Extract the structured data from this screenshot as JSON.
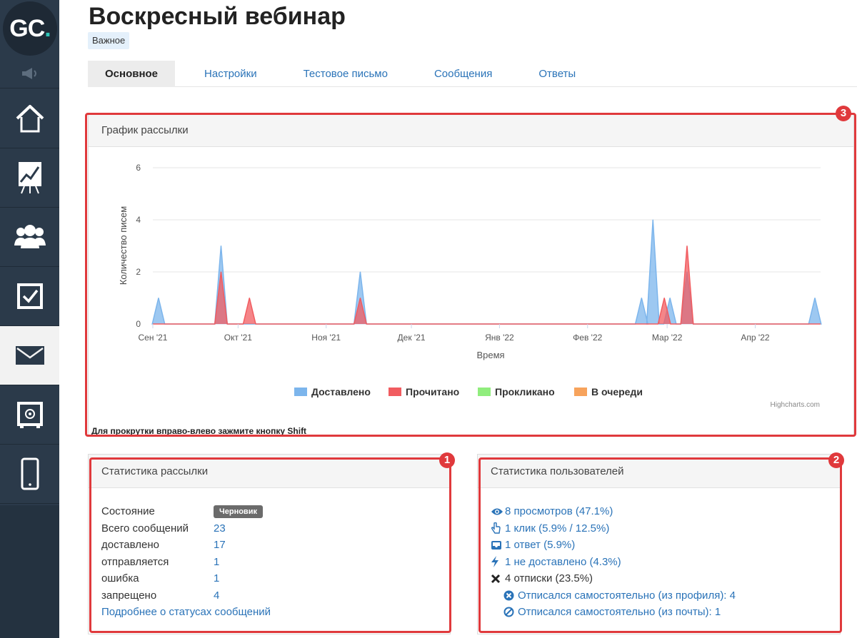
{
  "logo": {
    "text_main": "GC",
    "text_dot": "."
  },
  "sidebar": {
    "items": [
      {
        "name": "home"
      },
      {
        "name": "training"
      },
      {
        "name": "users"
      },
      {
        "name": "tasks"
      },
      {
        "name": "mail",
        "active": true
      },
      {
        "name": "safe"
      },
      {
        "name": "mobile"
      }
    ]
  },
  "page": {
    "title": "Воскресный вебинар",
    "tag": "Важное"
  },
  "tabs": [
    {
      "label": "Основное",
      "active": true
    },
    {
      "label": "Настройки"
    },
    {
      "label": "Тестовое письмо"
    },
    {
      "label": "Сообщения"
    },
    {
      "label": "Ответы"
    }
  ],
  "chart_panel": {
    "title": "График рассылки",
    "credit": "Highcharts.com",
    "scroll_note": "Для прокрутки вправо-влево зажмите кнопку Shift",
    "badge": "3"
  },
  "chart_data": {
    "type": "area",
    "ylabel": "Количество писем",
    "xlabel": "Время",
    "ylim": [
      0,
      6
    ],
    "yticks": [
      0,
      2,
      4,
      6
    ],
    "xlim": [
      "2021-09-01",
      "2022-04-24"
    ],
    "xticks": [
      {
        "date": "2021-09-01",
        "label": "Сен '21"
      },
      {
        "date": "2021-10-01",
        "label": "Окт '21"
      },
      {
        "date": "2021-11-01",
        "label": "Ноя '21"
      },
      {
        "date": "2021-12-01",
        "label": "Дек '21"
      },
      {
        "date": "2022-01-01",
        "label": "Янв '22"
      },
      {
        "date": "2022-02-01",
        "label": "Фев '22"
      },
      {
        "date": "2022-03-01",
        "label": "Мар '22"
      },
      {
        "date": "2022-04-01",
        "label": "Апр '22"
      }
    ],
    "legend_position": "bottom-center",
    "series": [
      {
        "name": "Доставлено",
        "color": "#7cb5ec",
        "points": [
          [
            "2021-09-03",
            1
          ],
          [
            "2021-09-25",
            3
          ],
          [
            "2021-11-13",
            2
          ],
          [
            "2022-02-20",
            1
          ],
          [
            "2022-02-24",
            4
          ],
          [
            "2022-03-02",
            1
          ],
          [
            "2022-03-08",
            2
          ],
          [
            "2022-04-22",
            1
          ]
        ]
      },
      {
        "name": "Прочитано",
        "color": "#f15c60",
        "points": [
          [
            "2021-09-25",
            2
          ],
          [
            "2021-10-05",
            1
          ],
          [
            "2021-11-13",
            1
          ],
          [
            "2022-02-28",
            1
          ],
          [
            "2022-03-08",
            3
          ]
        ]
      },
      {
        "name": "Прокликано",
        "color": "#90ed7d",
        "points": []
      },
      {
        "name": "В очереди",
        "color": "#f7a35c",
        "points": []
      }
    ]
  },
  "mail_stats": {
    "title": "Статистика рассылки",
    "badge": "1",
    "state_label": "Состояние",
    "state_value": "Черновик",
    "rows": [
      {
        "label": "Всего сообщений",
        "value": "23"
      },
      {
        "label": "доставлено",
        "value": "17"
      },
      {
        "label": "отправляется",
        "value": "1"
      },
      {
        "label": "ошибка",
        "value": "1"
      },
      {
        "label": "запрещено",
        "value": "4"
      }
    ],
    "more_link": "Подробнее о статусах сообщений"
  },
  "user_stats": {
    "title": "Статистика пользователей",
    "badge": "2",
    "views": "8 просмотров (47.1%)",
    "clicks": "1 клик (5.9% / 12.5%)",
    "replies": "1 ответ (5.9%)",
    "not_delivered": "1 не доставлено (4.3%)",
    "unsubscribes": "4 отписки (23.5%)",
    "unsub_profile": "Отписался самостоятельно (из профиля): 4",
    "unsub_email": "Отписался самостоятельно (из почты): 1"
  }
}
